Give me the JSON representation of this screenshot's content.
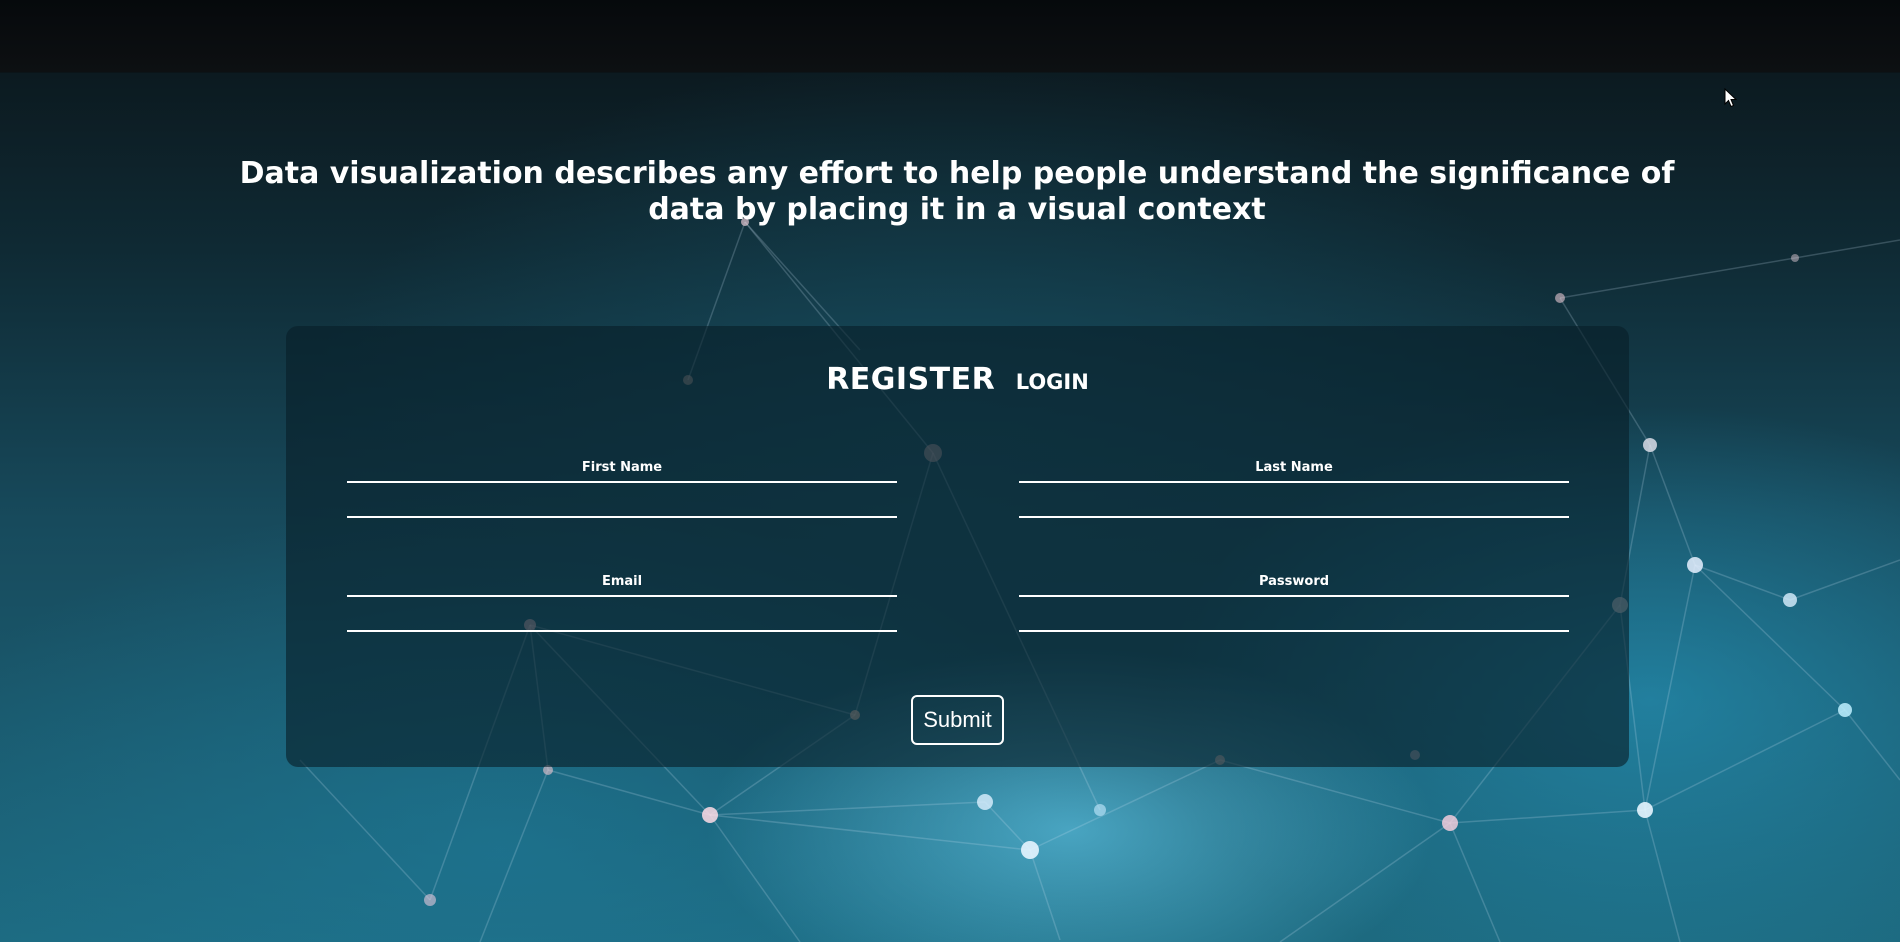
{
  "headline": "Data visualization describes any effort to help people understand the significance of data by placing it in a visual context",
  "tabs": {
    "register": "REGISTER",
    "login": "LOGIN"
  },
  "form": {
    "first_name_label": "First Name",
    "last_name_label": "Last Name",
    "email_label": "Email",
    "password_label": "Password",
    "submit_label": "Submit"
  },
  "icons": {
    "cursor": "mouse-pointer-icon"
  },
  "colors": {
    "text": "#ffffff",
    "background_top": "#0a0d10",
    "background_bottom": "#1d6a80",
    "card": "#081e28"
  }
}
